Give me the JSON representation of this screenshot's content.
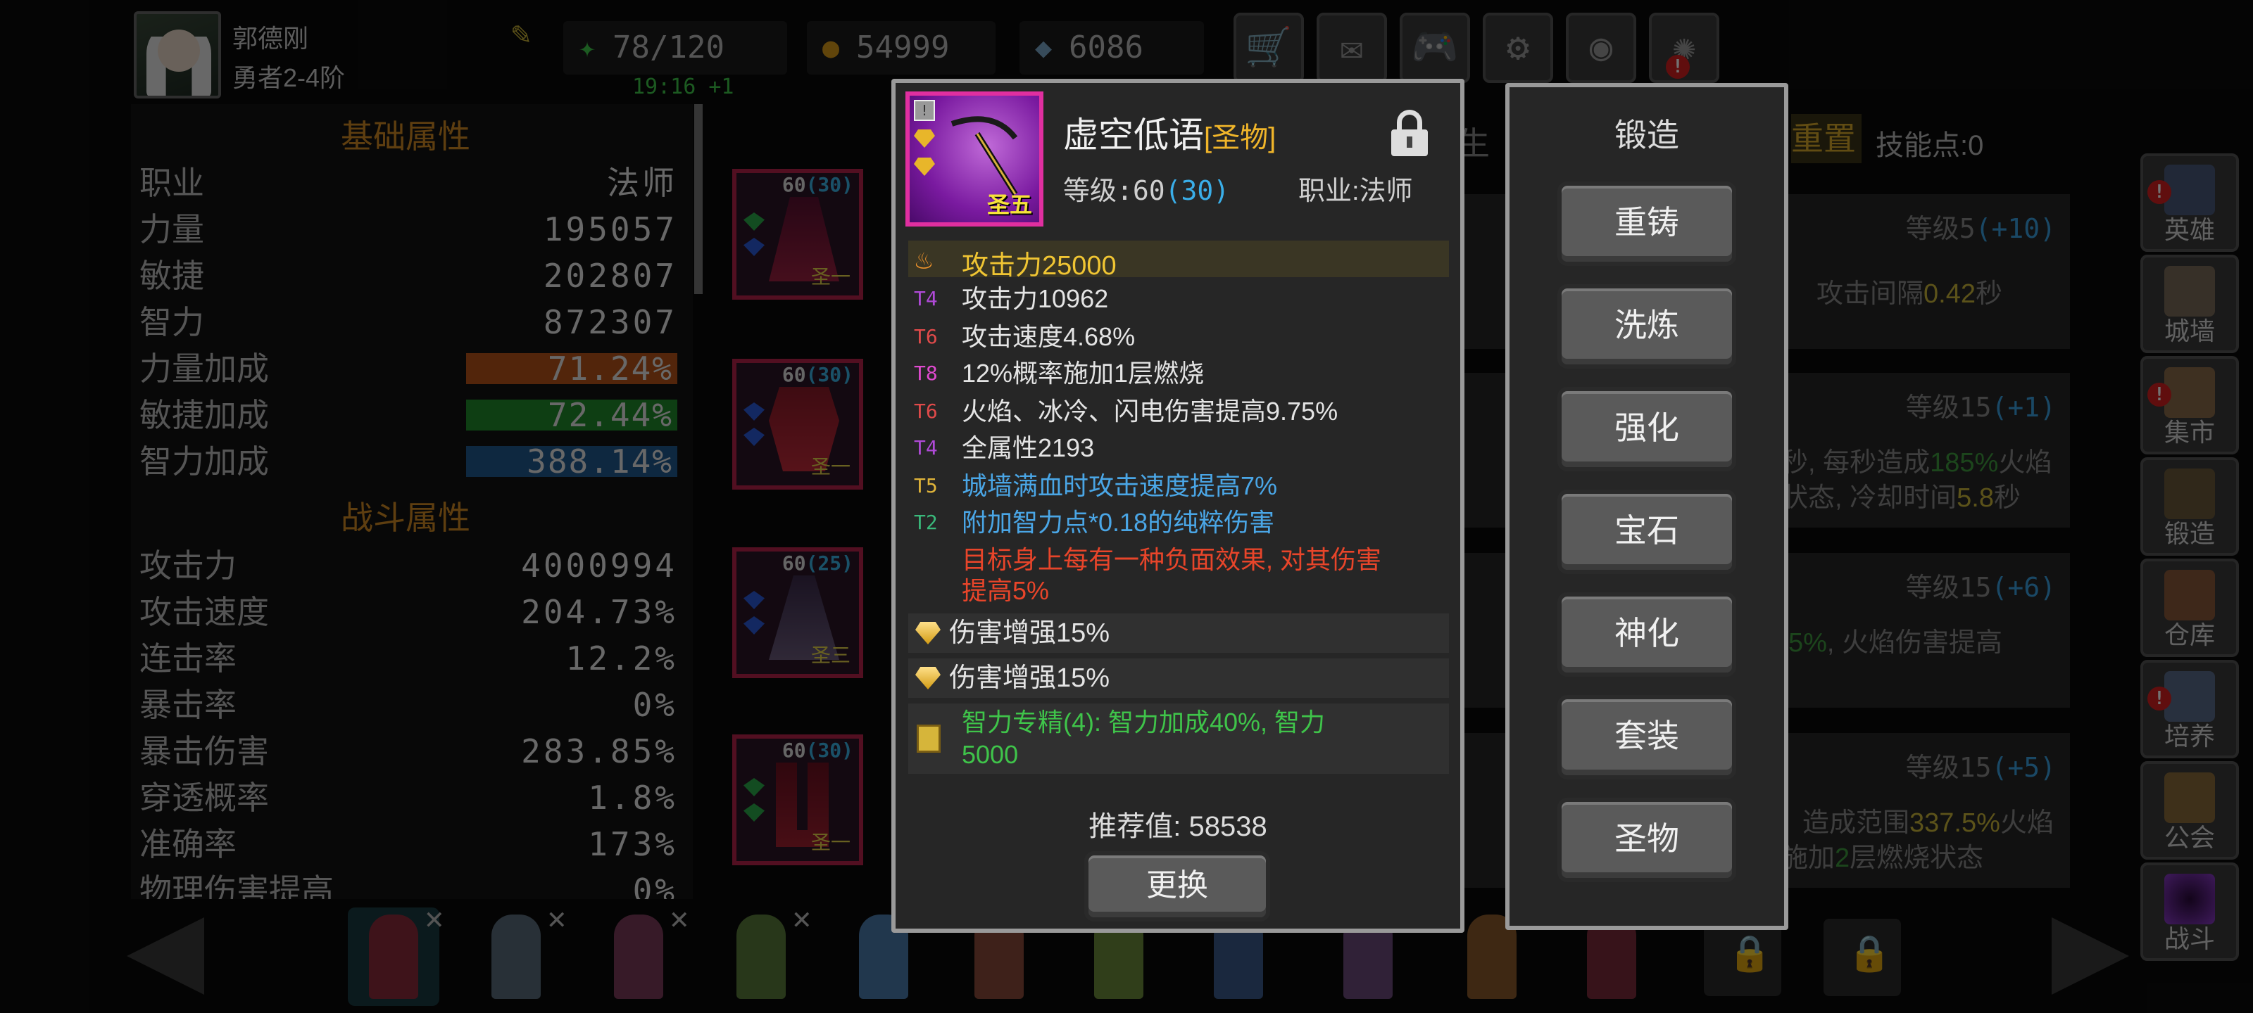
{
  "player": {
    "name": "郭德刚",
    "rank": "勇者2-4阶"
  },
  "resources": {
    "stamina": "78/120",
    "gold": "54999",
    "gems": "6086",
    "timer": "19:16 +1"
  },
  "top_buttons": [
    "shop-icon",
    "mail-icon",
    "gamepad-icon",
    "gear-icon",
    "camera-icon",
    "firework-icon"
  ],
  "stats": {
    "basic_title": "基础属性",
    "basic": [
      {
        "k": "职业",
        "v": "法师"
      },
      {
        "k": "力量",
        "v": "195057"
      },
      {
        "k": "敏捷",
        "v": "202807"
      },
      {
        "k": "智力",
        "v": "872307"
      }
    ],
    "bonus": [
      {
        "k": "力量加成",
        "v": "71.24%",
        "color": "#b5531a"
      },
      {
        "k": "敏捷加成",
        "v": "72.44%",
        "color": "#1f8a2a"
      },
      {
        "k": "智力加成",
        "v": "388.14%",
        "color": "#1f5a8e"
      }
    ],
    "combat_title": "战斗属性",
    "combat": [
      {
        "k": "攻击力",
        "v": "4000994"
      },
      {
        "k": "攻击速度",
        "v": "204.73%"
      },
      {
        "k": "连击率",
        "v": "12.2%"
      },
      {
        "k": "暴击率",
        "v": "0%"
      },
      {
        "k": "暴击伤害",
        "v": "283.85%"
      },
      {
        "k": "穿透概率",
        "v": "1.8%"
      },
      {
        "k": "准确率",
        "v": "173%"
      },
      {
        "k": "物理伤害提高",
        "v": "0%"
      }
    ]
  },
  "equipment": [
    {
      "level": "60",
      "plus": "(30)",
      "tier": "圣一"
    },
    {
      "level": "60",
      "plus": "(30)",
      "tier": "圣一"
    },
    {
      "level": "60",
      "plus": "(25)",
      "tier": "圣三"
    },
    {
      "level": "60",
      "plus": "(30)",
      "tier": "圣一"
    }
  ],
  "background_tabs": {
    "tab1": "生",
    "tab2": "重置",
    "skill_points": "技能点:0"
  },
  "skill_cards": [
    {
      "level": "等级5",
      "plus": "(+10)",
      "desc_a": "攻击间隔",
      "desc_hl": "0.42",
      "desc_b": "秒"
    },
    {
      "level": "等级15",
      "plus": "(+1)",
      "line1_a": "秒, 每秒造成",
      "line1_hl": "185%",
      "line1_b": "火焰",
      "line2_a": "状态, 冷却时间",
      "line2_hl": "5.8",
      "line2_b": "秒"
    },
    {
      "level": "等级15",
      "plus": "(+6)",
      "line1_hl": "5%",
      "line1_b": ", 火焰伤害提高"
    },
    {
      "level": "等级15",
      "plus": "(+5)",
      "line1_a": "造成范围",
      "line1_hl": "337.5%",
      "line1_b": "火焰",
      "line2_a": "施加",
      "line2_hl": "2",
      "line2_b": "层燃烧状态"
    }
  ],
  "sidebar": [
    {
      "label": "英雄",
      "alert": true,
      "color": "#4a5a7a"
    },
    {
      "label": "城墙",
      "alert": false,
      "color": "#7a6a5a"
    },
    {
      "label": "集市",
      "alert": true,
      "color": "#8a6a4a"
    },
    {
      "label": "锻造",
      "alert": false,
      "color": "#6a5a3a"
    },
    {
      "label": "仓库",
      "alert": false,
      "color": "#8a5a3a"
    },
    {
      "label": "培养",
      "alert": true,
      "color": "#5a6a8a"
    },
    {
      "label": "公会",
      "alert": false,
      "color": "#8a6a3a"
    },
    {
      "label": "战斗",
      "alert": false,
      "color": "#6a2a8a"
    }
  ],
  "item": {
    "name": "虚空低语",
    "type": "[圣物]",
    "tier": "圣五",
    "level_label": "等级:60",
    "level_plus": "(30)",
    "job": "职业:法师",
    "main_attr": "攻击力25000",
    "affixes": [
      {
        "tier": "T4",
        "text": "攻击力10962",
        "tier_color": "#b04ad8",
        "text_color": "#e4e4e4"
      },
      {
        "tier": "T6",
        "text": "攻击速度4.68%",
        "tier_color": "#e04a4a",
        "text_color": "#e4e4e4"
      },
      {
        "tier": "T8",
        "text": "12%概率施加1层燃烧",
        "tier_color": "#e04ad0",
        "text_color": "#e4e4e4"
      },
      {
        "tier": "T6",
        "text": "火焰、冰冷、闪电伤害提高9.75%",
        "tier_color": "#e04a4a",
        "text_color": "#e4e4e4"
      },
      {
        "tier": "T4",
        "text": "全属性2193",
        "tier_color": "#b04ad8",
        "text_color": "#e4e4e4"
      },
      {
        "tier": "T5",
        "text": "城墙满血时攻击速度提高7%",
        "tier_color": "#e0b43a",
        "text_color": "#4aa6e6"
      },
      {
        "tier": "T2",
        "text": "附加智力点*0.18的纯粹伤害",
        "tier_color": "#3ab87a",
        "text_color": "#4aa6e6"
      }
    ],
    "special_line1": "目标身上每有一种负面效果, 对其伤害",
    "special_line2": "提高5%",
    "gems": [
      "伤害增强15%",
      "伤害增强15%"
    ],
    "set_line1": "智力专精(4): 智力加成40%, 智力",
    "set_line2": "5000",
    "recommend": "推荐值: 58538",
    "replace_label": "更换"
  },
  "forge": {
    "title": "锻造",
    "buttons": [
      "重铸",
      "洗炼",
      "强化",
      "宝石",
      "神化",
      "套装",
      "圣物"
    ]
  },
  "bottom_heroes": [
    {
      "color": "#8a2a3a",
      "x": true,
      "selected": true
    },
    {
      "color": "#5a6a7a",
      "x": true
    },
    {
      "color": "#7a3a5a",
      "x": true
    },
    {
      "color": "#5a7a3a",
      "x": true
    },
    {
      "color": "#4a7aaa"
    },
    {
      "color": "#8a4a3a"
    },
    {
      "color": "#6a8a3a"
    },
    {
      "color": "#3a5a8a"
    },
    {
      "color": "#6a4a7a"
    },
    {
      "color": "#8a5a2a"
    },
    {
      "color": "#7a2a3a"
    }
  ]
}
